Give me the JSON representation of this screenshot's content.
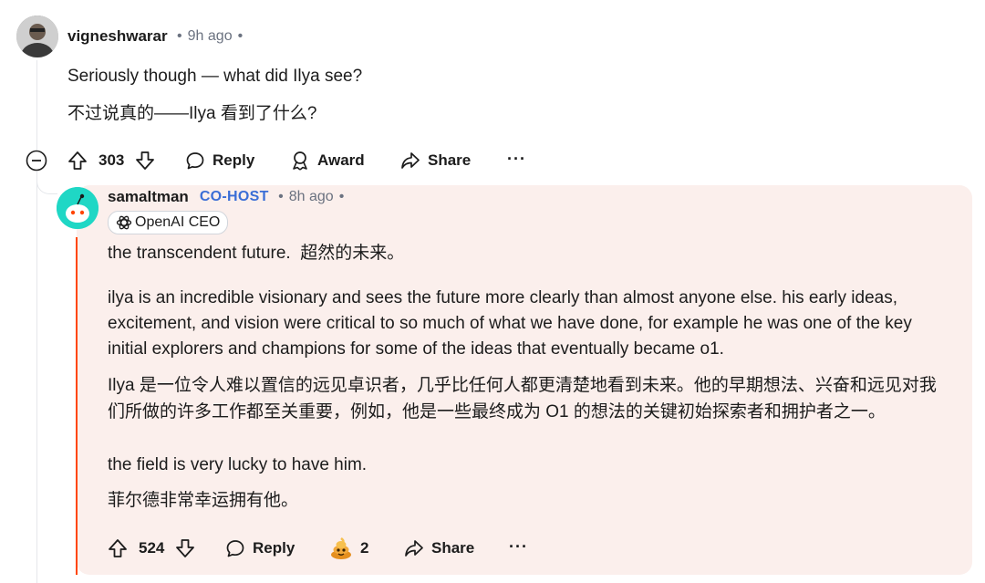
{
  "comment": {
    "username": "vigneshwarar",
    "time": "9h ago",
    "text_en": "Seriously though — what did Ilya see?",
    "text_zh": "不过说真的——Ilya 看到了什么?",
    "votes": "303",
    "reply_label": "Reply",
    "award_label": "Award",
    "share_label": "Share"
  },
  "reply": {
    "username": "samaltman",
    "badge": "CO-HOST",
    "time": "8h ago",
    "flair": "OpenAI CEO",
    "p1": "the transcendent future.  超然的未来。",
    "p2_lines": [
      "ilya is an incredible visionary and sees the future more clearly than almost anyone else. his early ideas,",
      "excitement, and vision were critical to so much of what we have done, for example he was one of the key",
      "initial explorers and champions for some of the ideas that eventually became o1."
    ],
    "p3_lines": [
      "Ilya 是一位令人难以置信的远见卓识者，几乎比任何人都更清楚地看到未来。他的早期想法、兴奋和远见对我",
      "们所做的许多工作都至关重要，例如，他是一些最终成为 O1 的想法的关键初始探索者和拥护者之一。"
    ],
    "p4": "the field is very lucky to have him.",
    "p5": "菲尔德非常幸运拥有他。",
    "votes": "524",
    "reply_label": "Reply",
    "award_count": "2",
    "share_label": "Share"
  },
  "colors": {
    "accent": "#ff4500",
    "cohost": "#3b6ed6",
    "reply_bg": "#fbefec"
  },
  "icons": [
    "avatar",
    "collapse-icon",
    "upvote-icon",
    "downvote-icon",
    "reply-icon",
    "award-icon",
    "share-icon",
    "more-icon",
    "openai-logo-icon",
    "award-emoji-icon"
  ]
}
